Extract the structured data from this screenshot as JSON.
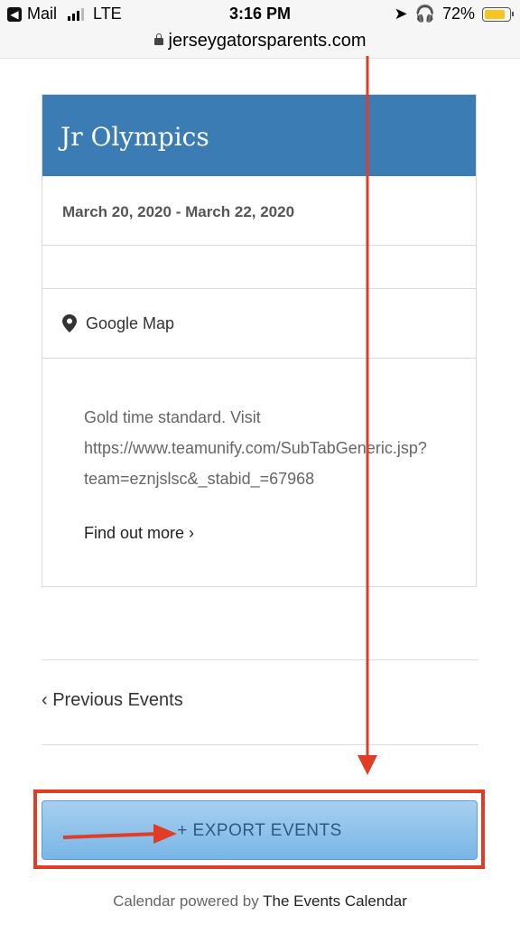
{
  "status_bar": {
    "carrier": "Mail",
    "network": "LTE",
    "time": "3:16 PM",
    "battery": "72%",
    "battery_level": 0.72
  },
  "url_bar": {
    "domain": "jerseygatorsparents.com"
  },
  "event": {
    "title": "Jr Olympics",
    "dates": "March 20, 2020 - March 22, 2020",
    "map_link": "Google Map",
    "description_lines": [
      "Gold time standard.  Visit",
      "https://www.teamunify.com/SubTabGeneric.jsp?",
      "team=eznjslsc&_stabid_=67968"
    ],
    "find_out_more": "Find out more ›"
  },
  "nav": {
    "previous_events": "‹ Previous Events"
  },
  "export": {
    "label": "+ EXPORT EVENTS"
  },
  "footer": {
    "prefix": "Calendar powered by ",
    "brand": "The Events Calendar"
  },
  "colors": {
    "header_blue": "#3b7cb5",
    "annotation_red": "#e03c26",
    "button_blue": "#8cc3ec"
  }
}
